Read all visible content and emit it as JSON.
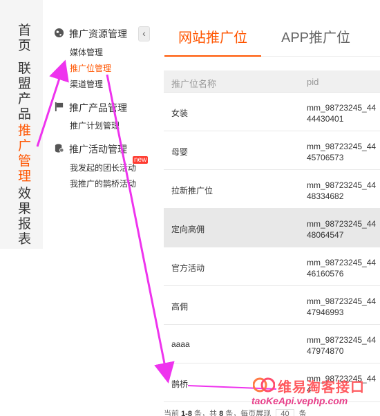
{
  "main_nav": [
    {
      "label": "首页",
      "active": false
    },
    {
      "label": "联盟产品",
      "active": false
    },
    {
      "label": "推广管理",
      "active": true
    },
    {
      "label": "效果报表",
      "active": false
    }
  ],
  "sub_nav": {
    "collapse_icon": "chevron-left-icon",
    "groups": [
      {
        "title": "推广资源管理",
        "icon": "globe-icon",
        "items": [
          "媒体管理",
          "推广位管理",
          "渠道管理"
        ]
      },
      {
        "title": "推广产品管理",
        "icon": "flag-icon",
        "items": [
          "推广计划管理"
        ]
      },
      {
        "title": "推广活动管理",
        "icon": "coins-icon",
        "items": [
          "我发起的团长活动",
          "我推广的鹊桥活动"
        ]
      }
    ],
    "active_item": "推广位管理",
    "new_badge": "new"
  },
  "tabs": [
    {
      "label": "网站推广位",
      "active": true
    },
    {
      "label": "APP推广位",
      "active": false
    }
  ],
  "table": {
    "columns": [
      "推广位名称",
      "pid"
    ],
    "rows": [
      {
        "name": "女装",
        "pid": "mm_98723245_4444430401"
      },
      {
        "name": "母婴",
        "pid": "mm_98723245_4445706573"
      },
      {
        "name": "拉新推广位",
        "pid": "mm_98723245_4448334682"
      },
      {
        "name": "定向高佣",
        "pid": "mm_98723245_4448064547"
      },
      {
        "name": "官方活动",
        "pid": "mm_98723245_4446160576"
      },
      {
        "name": "高佣",
        "pid": "mm_98723245_4447946993"
      },
      {
        "name": "aaaa",
        "pid": "mm_98723245_4447974870"
      },
      {
        "name": "鹊桥",
        "pid": "mm_98723245_444"
      }
    ]
  },
  "footer": {
    "prefix": "当前",
    "range": "1-8",
    "unit1": "条，共",
    "total": "8",
    "unit2": "条，每页展现",
    "page_size": "40",
    "unit3": "条"
  },
  "watermark": {
    "title": "维易淘客接口",
    "url": "taoKeApi.vephp.com"
  },
  "colors": {
    "accent": "#ff5500",
    "annotation_arrow": "#ee33ee"
  }
}
